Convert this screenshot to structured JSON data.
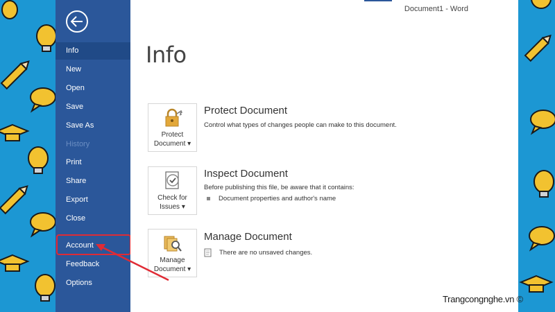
{
  "window": {
    "title": "Document1  -  Word"
  },
  "nav": {
    "items": [
      {
        "label": "Info",
        "state": "active"
      },
      {
        "label": "New",
        "state": "normal"
      },
      {
        "label": "Open",
        "state": "normal"
      },
      {
        "label": "Save",
        "state": "normal"
      },
      {
        "label": "Save As",
        "state": "normal"
      },
      {
        "label": "History",
        "state": "disabled"
      },
      {
        "label": "Print",
        "state": "normal"
      },
      {
        "label": "Share",
        "state": "normal"
      },
      {
        "label": "Export",
        "state": "normal"
      },
      {
        "label": "Close",
        "state": "normal"
      },
      {
        "label": "Account",
        "state": "highlighted"
      },
      {
        "label": "Feedback",
        "state": "normal"
      },
      {
        "label": "Options",
        "state": "normal"
      }
    ]
  },
  "main": {
    "title": "Info",
    "sections": [
      {
        "tile_line1": "Protect",
        "tile_line2": "Document ▾",
        "title": "Protect Document",
        "desc": "Control what types of changes people can make to this document."
      },
      {
        "tile_line1": "Check for",
        "tile_line2": "Issues ▾",
        "title": "Inspect Document",
        "desc": "Before publishing this file, be aware that it contains:",
        "bullet": "Document properties and author's name"
      },
      {
        "tile_line1": "Manage",
        "tile_line2": "Document ▾",
        "title": "Manage Document",
        "bullet": "There are no unsaved changes."
      }
    ]
  },
  "watermark": "Trangcongnghe.vn ©",
  "colors": {
    "nav_bg": "#2b579a",
    "nav_active": "#204a87",
    "highlight": "#e02b35",
    "background_pattern": "#1c97d3"
  },
  "icons": [
    "back-arrow-icon",
    "lock-key-icon",
    "checklist-icon",
    "documents-search-icon",
    "lightbulb-icon",
    "pencil-icon",
    "speech-bubble-icon",
    "graduation-cap-icon"
  ]
}
